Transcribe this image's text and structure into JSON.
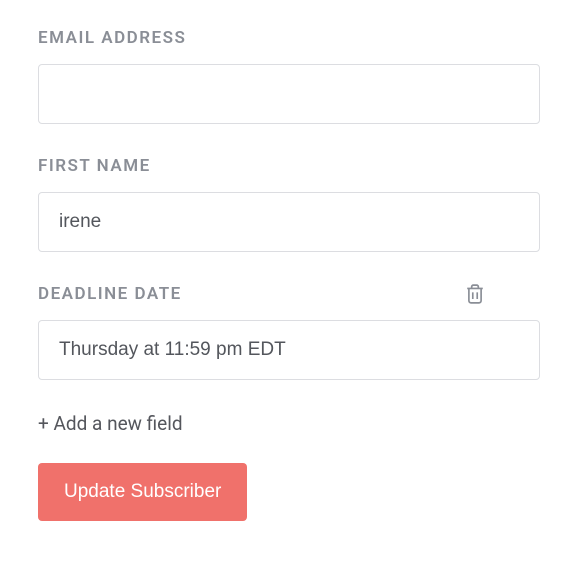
{
  "fields": {
    "email": {
      "label": "EMAIL ADDRESS",
      "value": ""
    },
    "firstName": {
      "label": "FIRST NAME",
      "value": "irene"
    },
    "deadline": {
      "label": "DEADLINE DATE",
      "value": "Thursday at 11:59 pm EDT"
    }
  },
  "addFieldText": "+ Add a new field",
  "updateButtonText": "Update Subscriber"
}
